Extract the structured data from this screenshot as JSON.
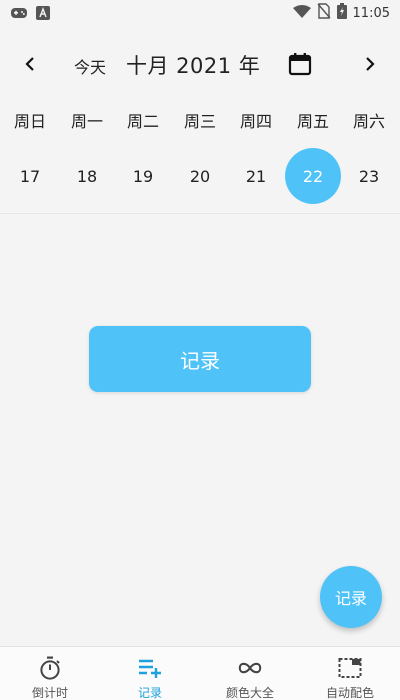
{
  "status_bar": {
    "time": "11:05",
    "icons": [
      "gamepad-icon",
      "font-a-icon",
      "wifi-icon",
      "no-sim-icon",
      "battery-charging-icon"
    ]
  },
  "calendar": {
    "today_label": "今天",
    "month_title": "十月 2021 年",
    "weekdays": [
      "周日",
      "周一",
      "周二",
      "周三",
      "周四",
      "周五",
      "周六"
    ],
    "days": [
      "17",
      "18",
      "19",
      "20",
      "21",
      "22",
      "23"
    ],
    "selected_day": "22"
  },
  "main": {
    "record_button_label": "记录"
  },
  "fab": {
    "label": "记录"
  },
  "bottom_nav": {
    "items": [
      {
        "label": "倒计时",
        "icon": "stopwatch-icon"
      },
      {
        "label": "记录",
        "icon": "add-list-icon"
      },
      {
        "label": "颜色大全",
        "icon": "infinity-icon"
      },
      {
        "label": "自动配色",
        "icon": "dashed-frame-icon"
      }
    ],
    "active_index": 1
  },
  "colors": {
    "accent": "#4fc3f7",
    "active_nav": "#1ea1dc",
    "background": "#f4f4f4"
  }
}
